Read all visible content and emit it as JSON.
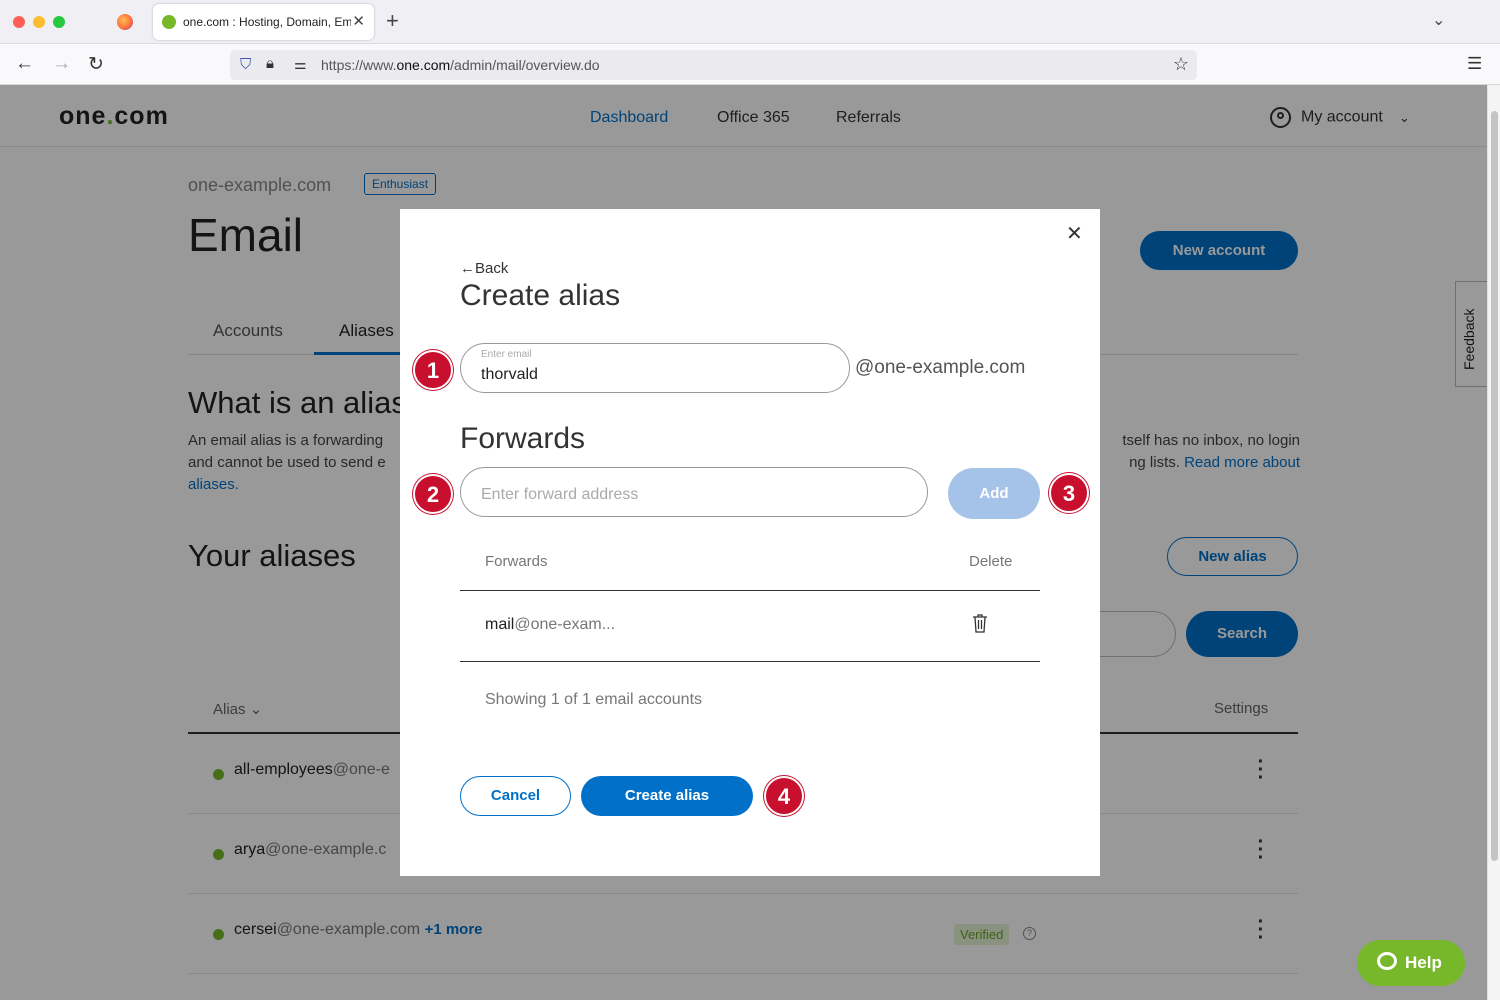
{
  "browser": {
    "tab_title": "one.com : Hosting, Domain, Email",
    "tab_close": "✕",
    "new_tab": "+",
    "url_prefix": "https://www.",
    "url_host": "one.com",
    "url_path": "/admin/mail/overview.do"
  },
  "header": {
    "logo_before": "one",
    "logo_dot": ".",
    "logo_after": "com",
    "nav": [
      "Dashboard",
      "Office 365",
      "Referrals"
    ],
    "active_nav": "Dashboard",
    "account": "My account"
  },
  "page": {
    "domain": "one-example.com",
    "plan_badge": "Enthusiast",
    "title": "Email",
    "new_account": "New account",
    "tabs": [
      "Accounts",
      "Aliases"
    ],
    "what_title": "What is an alias",
    "what_line1_left": "An email alias is a forwarding",
    "what_line1_right": "tself has no inbox, no login",
    "what_line2_left": "and cannot be used to send e",
    "what_line2_right": "ng lists.",
    "read_more": "Read more about",
    "read_more_2": "aliases.",
    "your_aliases": "Your aliases",
    "new_alias": "New alias",
    "search": "Search",
    "col_alias": "Alias",
    "col_settings": "Settings",
    "rows": [
      {
        "name": "all-employees",
        "domain": "@one-e",
        "more": "",
        "verified": ""
      },
      {
        "name": "arya",
        "domain": "@one-example.c",
        "more": "",
        "verified": ""
      },
      {
        "name": "cersei",
        "domain": "@one-example.com",
        "more": "+1 more",
        "verified": "Verified"
      }
    ],
    "feedback": "Feedback",
    "help": "Help"
  },
  "modal": {
    "back": "Back",
    "title": "Create alias",
    "email_label": "Enter email",
    "email_value": "thorvald",
    "email_suffix": "@one-example.com",
    "forwards_title": "Forwards",
    "forward_placeholder": "Enter forward address",
    "add": "Add",
    "table_col_forwards": "Forwards",
    "table_col_delete": "Delete",
    "forward_row_name": "mail",
    "forward_row_domain": "@one-exam...",
    "showing": "Showing 1 of 1 email accounts",
    "cancel": "Cancel",
    "create": "Create alias",
    "markers": [
      "1",
      "2",
      "3",
      "4"
    ]
  },
  "colors": {
    "accent": "#0070c9",
    "brand_green": "#76b82a",
    "marker_red": "#c8102e",
    "add_disabled": "#a5c3e8"
  },
  "icons": [
    "firefox-icon",
    "back-icon",
    "forward-icon",
    "reload-icon",
    "shield-icon",
    "lock-icon",
    "permissions-icon",
    "bookmark-star-icon",
    "hamburger-menu-icon",
    "user-icon",
    "chevron-down-icon",
    "close-icon",
    "arrow-left-icon",
    "trash-icon",
    "kebab-icon",
    "question-icon",
    "help-chat-icon"
  ]
}
